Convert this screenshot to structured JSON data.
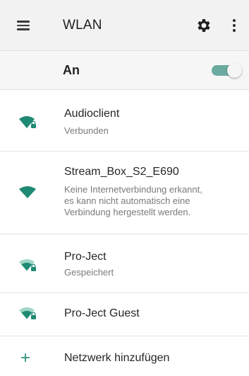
{
  "appbar": {
    "title": "WLAN",
    "menu_icon": "hamburger-menu-icon",
    "settings_icon": "gear-icon",
    "more_icon": "more-vert-icon"
  },
  "master": {
    "label": "An",
    "toggle_state": "on",
    "toggle_color": "#6aaa9f"
  },
  "networks": [
    {
      "name": "Audioclient",
      "status": "Verbunden",
      "icon": "wifi-locked-icon"
    },
    {
      "name": "Stream_Box_S2_E690",
      "status_lines": [
        "Keine Internetverbindung erkannt,",
        "es kann nicht automatisch eine",
        "Verbindung hergestellt werden."
      ],
      "icon": "wifi-full-icon"
    },
    {
      "name": "Pro-Ject",
      "status": "Gespeichert",
      "icon": "wifi-locked-icon"
    },
    {
      "name": "Pro-Ject Guest",
      "icon": "wifi-locked-icon"
    }
  ],
  "add_network": {
    "label": "Netzwerk hinzufügen",
    "icon": "plus-icon"
  },
  "colors": {
    "accent": "#2f8f7c",
    "wifi_strong": "#1f8a73",
    "wifi_weak": "#9fd6c8",
    "appbar_bg": "#f2f2f2"
  }
}
